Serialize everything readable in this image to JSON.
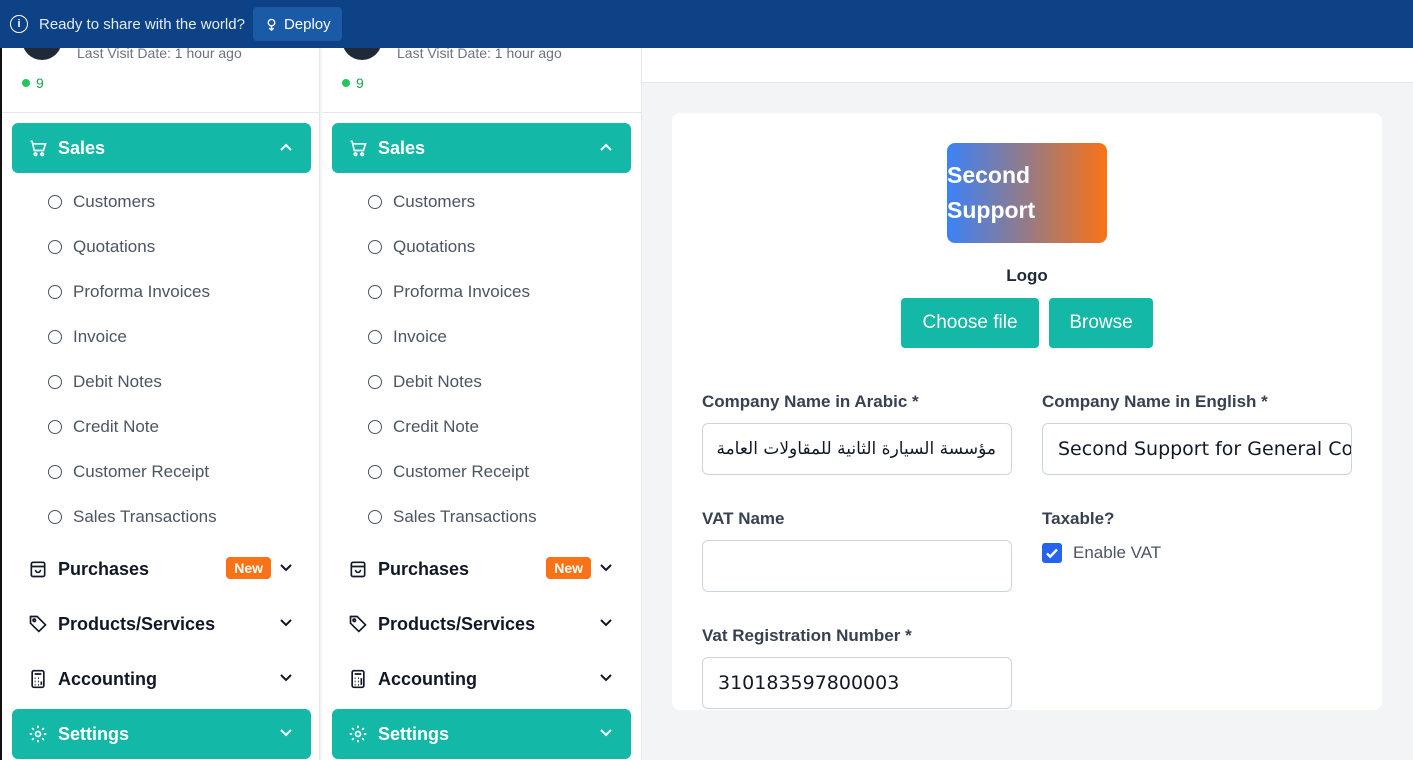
{
  "banner": {
    "text": "Ready to share with the world?",
    "deploy_label": "Deploy"
  },
  "sidebar": {
    "last_visit": "Last Visit Date: 1 hour ago",
    "online_count": "9",
    "sales_label": "Sales",
    "sales_items": [
      "Customers",
      "Quotations",
      "Proforma Invoices",
      "Invoice",
      "Debit Notes",
      "Credit Note",
      "Customer Receipt",
      "Sales Transactions"
    ],
    "purchases_label": "Purchases",
    "new_badge": "New",
    "products_label": "Products/Services",
    "accounting_label": "Accounting",
    "settings_label": "Settings"
  },
  "form": {
    "logo_text": [
      "Second",
      "Support"
    ],
    "logo_label": "Logo",
    "choose_file_label": "Choose file",
    "browse_label": "Browse",
    "company_name_ar_label": "Company Name in Arabic *",
    "company_name_ar_value": "مؤسسة السيارة الثانية للمقاولات العامة",
    "company_name_en_label": "Company Name in English *",
    "company_name_en_value": "Second Support for General Contracting",
    "vat_name_label": "VAT Name",
    "vat_name_value": "",
    "taxable_label": "Taxable?",
    "enable_vat_label": "Enable VAT",
    "enable_vat_checked": true,
    "vat_reg_label": "Vat Registration Number *",
    "vat_reg_value": "310183597800003"
  },
  "colors": {
    "accent": "#14b8a6",
    "banner": "#0d4286",
    "badge": "#f97316",
    "checkbox": "#2563eb"
  }
}
